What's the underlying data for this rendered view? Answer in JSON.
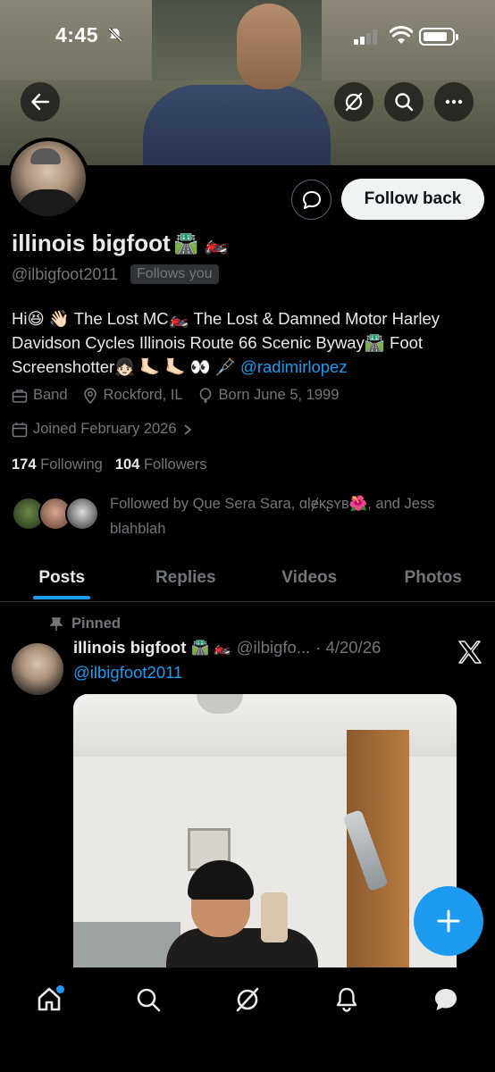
{
  "status_bar": {
    "time": "4:45"
  },
  "profile": {
    "display_name": "illinois bigfoot",
    "name_emojis": "🛣️ 🏍️",
    "handle": "@ilbigfoot2011",
    "follows_you": "Follows you",
    "follow_button": "Follow back",
    "bio_text": "Hi😆 👋🏻 The Lost MC🏍️ The Lost & Damned Motor Harley Davidson Cycles Illinois Route 66 Scenic Byway🛣️ Foot Screenshotter👧🏻 🦶🏻 🦶🏻 👀 🩼 ",
    "bio_mention": "@radimirlopez",
    "category": "Band",
    "location": "Rockford, IL",
    "born": "Born June 5, 1999",
    "joined": "Joined February 2026",
    "following_count": "174",
    "following_label": "Following",
    "followers_count": "104",
    "followers_label": "Followers",
    "followed_by": "Followed by Que Sera Sara, ɑƖɇᴋʂʏʙ🌺, and Jess blahblah"
  },
  "tabs": [
    {
      "label": "Posts",
      "active": true
    },
    {
      "label": "Replies",
      "active": false
    },
    {
      "label": "Videos",
      "active": false
    },
    {
      "label": "Photos",
      "active": false
    }
  ],
  "post": {
    "pinned_label": "Pinned",
    "author_name": "illinois bigfoot",
    "author_emojis": "🛣️ 🏍️",
    "author_handle": "@ilbigfo...",
    "date": "· 4/20/26",
    "mention": "@ilbigfoot2011"
  },
  "colors": {
    "accent": "#1d9bf0",
    "muted": "#71767b",
    "background": "#000000"
  },
  "icons": [
    "back-arrow-icon",
    "grok-icon",
    "search-icon",
    "more-icon",
    "message-icon",
    "briefcase-icon",
    "location-icon",
    "balloon-icon",
    "calendar-icon",
    "pin-icon",
    "x-logo-icon",
    "plus-icon",
    "home-icon",
    "notifications-icon",
    "chat-icon"
  ]
}
